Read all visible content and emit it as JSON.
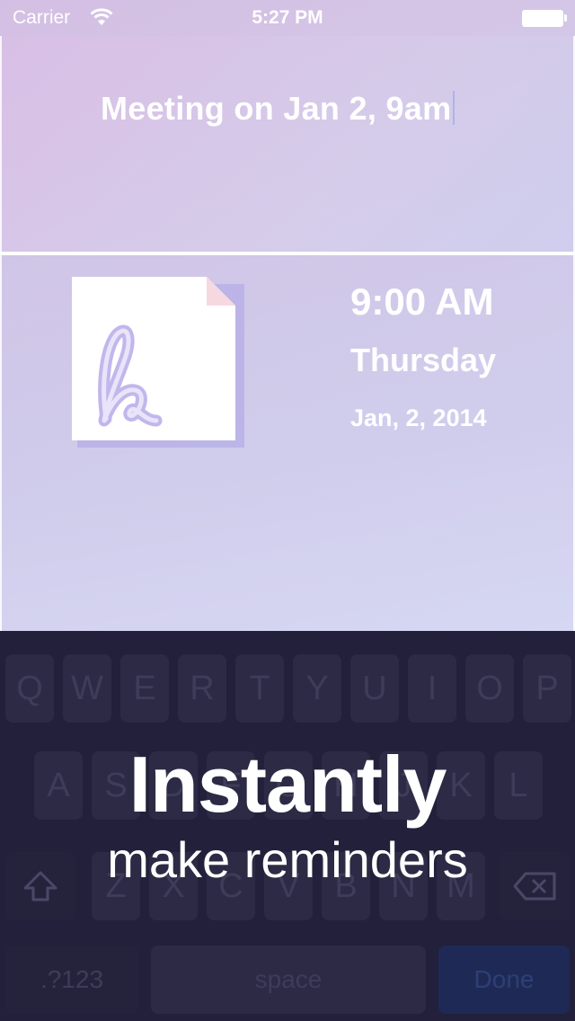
{
  "status_bar": {
    "carrier": "Carrier",
    "time": "5:27 PM"
  },
  "input": {
    "text": "Meeting on Jan 2, 9am"
  },
  "preview": {
    "icon": "app-logo-note-icon",
    "time": "9:00 AM",
    "day": "Thursday",
    "date": "Jan, 2, 2014"
  },
  "keyboard": {
    "row1": [
      "Q",
      "W",
      "E",
      "R",
      "T",
      "Y",
      "U",
      "I",
      "O",
      "P"
    ],
    "row2": [
      "A",
      "S",
      "D",
      "F",
      "G",
      "H",
      "J",
      "K",
      "L"
    ],
    "row3": [
      "Z",
      "X",
      "C",
      "V",
      "B",
      "N",
      "M"
    ],
    "numbers_label": ".?123",
    "space_label": "space",
    "done_label": "Done"
  },
  "caption": {
    "headline": "Instantly",
    "subline": "make reminders"
  },
  "colors": {
    "keyboard_bg": "#22203a",
    "key_bg": "#2c2a44",
    "done_bg": "#1e2a55",
    "accent": "#aab4ec"
  }
}
